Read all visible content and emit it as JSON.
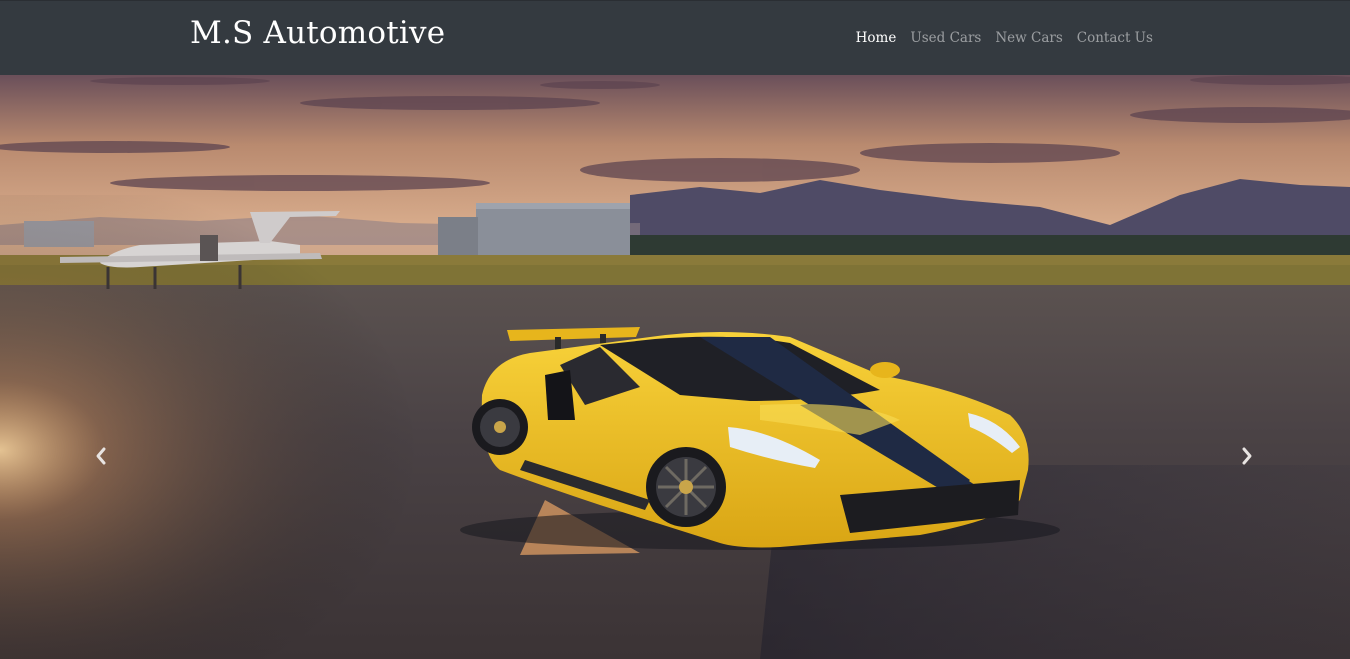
{
  "navbar": {
    "brand": "M.S Automotive",
    "links": [
      {
        "label": "Home",
        "active": true
      },
      {
        "label": "Used Cars",
        "active": false
      },
      {
        "label": "New Cars",
        "active": false
      },
      {
        "label": "Contact Us",
        "active": false
      }
    ]
  },
  "carousel": {
    "slide_subject": "yellow sports car on airport tarmac at sunset",
    "prev_icon": "chevron-left-icon",
    "next_icon": "chevron-right-icon"
  },
  "colors": {
    "navbar_bg": "#343a40",
    "nav_active": "#ffffff",
    "nav_inactive": "#9a9da1",
    "car_yellow": "#f2c21a",
    "stripe": "#1f2a44"
  }
}
